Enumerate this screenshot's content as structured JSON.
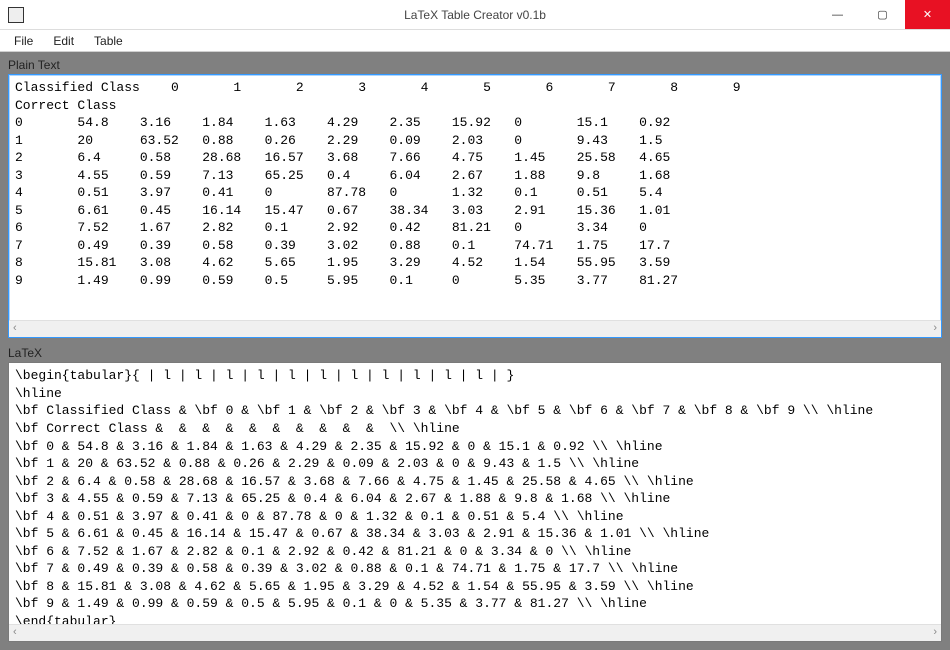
{
  "window": {
    "title": "LaTeX Table Creator v0.1b"
  },
  "menu": {
    "items": [
      "File",
      "Edit",
      "Table"
    ]
  },
  "labels": {
    "plain_text": "Plain Text",
    "latex": "LaTeX"
  },
  "header1": "Classified Class",
  "header2": "Correct Class",
  "columns": [
    "0",
    "1",
    "2",
    "3",
    "4",
    "5",
    "6",
    "7",
    "8",
    "9"
  ],
  "rows": [
    {
      "label": "0",
      "cells": [
        "54.8",
        "3.16",
        "1.84",
        "1.63",
        "4.29",
        "2.35",
        "15.92",
        "0",
        "15.1",
        "0.92"
      ]
    },
    {
      "label": "1",
      "cells": [
        "20",
        "63.52",
        "0.88",
        "0.26",
        "2.29",
        "0.09",
        "2.03",
        "0",
        "9.43",
        "1.5"
      ]
    },
    {
      "label": "2",
      "cells": [
        "6.4",
        "0.58",
        "28.68",
        "16.57",
        "3.68",
        "7.66",
        "4.75",
        "1.45",
        "25.58",
        "4.65"
      ]
    },
    {
      "label": "3",
      "cells": [
        "4.55",
        "0.59",
        "7.13",
        "65.25",
        "0.4",
        "6.04",
        "2.67",
        "1.88",
        "9.8",
        "1.68"
      ]
    },
    {
      "label": "4",
      "cells": [
        "0.51",
        "3.97",
        "0.41",
        "0",
        "87.78",
        "0",
        "1.32",
        "0.1",
        "0.51",
        "5.4"
      ]
    },
    {
      "label": "5",
      "cells": [
        "6.61",
        "0.45",
        "16.14",
        "15.47",
        "0.67",
        "38.34",
        "3.03",
        "2.91",
        "15.36",
        "1.01"
      ]
    },
    {
      "label": "6",
      "cells": [
        "7.52",
        "1.67",
        "2.82",
        "0.1",
        "2.92",
        "0.42",
        "81.21",
        "0",
        "3.34",
        "0"
      ]
    },
    {
      "label": "7",
      "cells": [
        "0.49",
        "0.39",
        "0.58",
        "0.39",
        "3.02",
        "0.88",
        "0.1",
        "74.71",
        "1.75",
        "17.7"
      ]
    },
    {
      "label": "8",
      "cells": [
        "15.81",
        "3.08",
        "4.62",
        "5.65",
        "1.95",
        "3.29",
        "4.52",
        "1.54",
        "55.95",
        "3.59"
      ]
    },
    {
      "label": "9",
      "cells": [
        "1.49",
        "0.99",
        "0.59",
        "0.5",
        "5.95",
        "0.1",
        "0",
        "5.35",
        "3.77",
        "81.27"
      ]
    }
  ],
  "latex": {
    "begin": "\\begin{tabular}{ | l | l | l | l | l | l | l | l | l | l | l | }",
    "end": "\\end{tabular}"
  }
}
